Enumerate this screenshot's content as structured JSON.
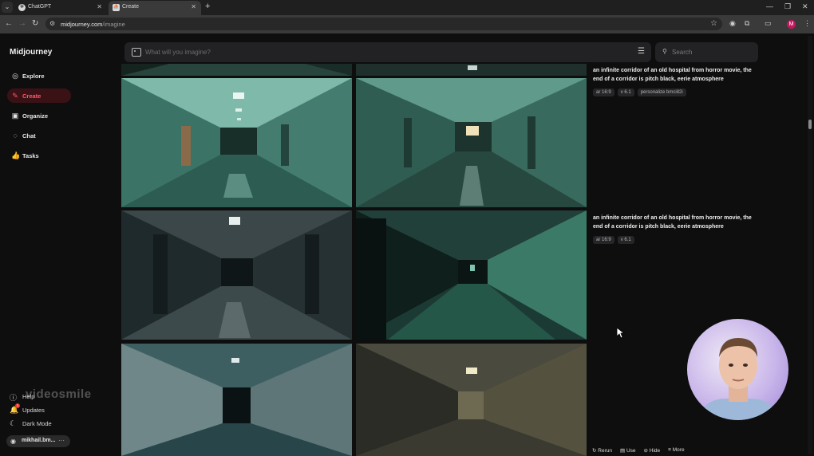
{
  "browser": {
    "tabs": [
      {
        "title": "ChatGPT",
        "favicon": "openai-icon",
        "active": false
      },
      {
        "title": "Create",
        "favicon": "midjourney-icon",
        "active": true
      }
    ],
    "url_host": "midjourney.com",
    "url_path": "/imagine"
  },
  "sidebar": {
    "brand": "Midjourney",
    "items": [
      {
        "label": "Explore",
        "icon": "compass-icon",
        "active": false
      },
      {
        "label": "Create",
        "icon": "brush-icon",
        "active": true
      },
      {
        "label": "Organize",
        "icon": "gallery-icon",
        "active": false
      },
      {
        "label": "Chat",
        "icon": "chat-icon",
        "active": false
      },
      {
        "label": "Tasks",
        "icon": "thumbs-up-icon",
        "active": false
      }
    ],
    "bottom": [
      {
        "label": "Help",
        "icon": "help-icon"
      },
      {
        "label": "Updates",
        "icon": "bell-icon",
        "badge": "3"
      },
      {
        "label": "Dark Mode",
        "icon": "moon-icon"
      }
    ],
    "account": "mikhail.bm..."
  },
  "topbar": {
    "prompt_placeholder": "What will you imagine?",
    "search_placeholder": "Search"
  },
  "jobs": [
    {
      "prompt": "an infinite corridor of an old hospital from horror movie, the end of a corridor is pitch black, eerie atmosphere",
      "params": [
        "ar 16:9",
        "v 6.1",
        "personalize bmci82i"
      ]
    },
    {
      "prompt": "an infinite corridor of an old hospital from horror movie, the end of a corridor is pitch black, eerie atmosphere",
      "params": [
        "ar 16:9",
        "v 6.1"
      ]
    }
  ],
  "actions": [
    "Rerun",
    "Use",
    "Hide",
    "More"
  ],
  "watermark": "videosmile",
  "colors": {
    "accent": "#ff5a6a",
    "background": "#0e0e0f"
  }
}
